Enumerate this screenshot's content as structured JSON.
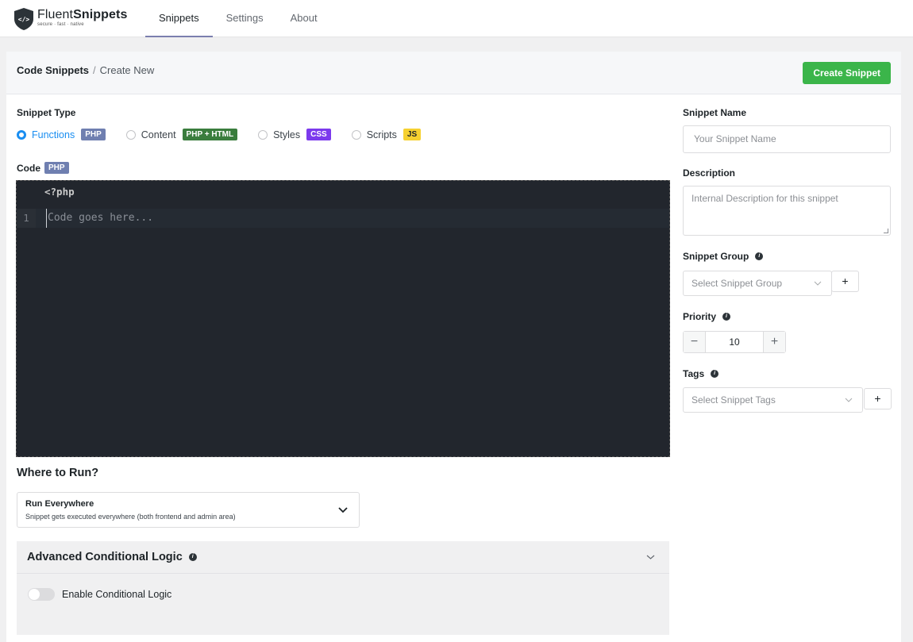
{
  "header": {
    "logo": {
      "name_thin": "Fluent",
      "name_bold": "Snippets",
      "tagline": "secure · fast · native"
    },
    "nav": [
      {
        "label": "Snippets",
        "active": true
      },
      {
        "label": "Settings",
        "active": false
      },
      {
        "label": "About",
        "active": false
      }
    ]
  },
  "breadcrumb": {
    "root": "Code Snippets",
    "separator": "/",
    "current": "Create New"
  },
  "create_button": "Create Snippet",
  "snippet_type": {
    "label": "Snippet Type",
    "options": [
      {
        "name": "Functions",
        "badge": "PHP",
        "selected": true
      },
      {
        "name": "Content",
        "badge": "PHP + HTML",
        "selected": false
      },
      {
        "name": "Styles",
        "badge": "CSS",
        "selected": false
      },
      {
        "name": "Scripts",
        "badge": "JS",
        "selected": false
      }
    ]
  },
  "code": {
    "label": "Code",
    "badge": "PHP",
    "opening_tag": "<?php",
    "line_number": "1",
    "placeholder": "Code goes here..."
  },
  "where_to_run": {
    "label": "Where to Run?",
    "selected_title": "Run Everywhere",
    "selected_desc": "Snippet gets executed everywhere (both frontend and admin area)"
  },
  "advanced": {
    "title": "Advanced Conditional Logic",
    "toggle_label": "Enable Conditional Logic",
    "enabled": false
  },
  "sidebar": {
    "name_label": "Snippet Name",
    "name_placeholder": "Your Snippet Name",
    "description_label": "Description",
    "description_placeholder": "Internal Description for this snippet",
    "group_label": "Snippet Group",
    "group_placeholder": "Select Snippet Group",
    "priority_label": "Priority",
    "priority_value": "10",
    "tags_label": "Tags",
    "tags_placeholder": "Select Snippet Tags",
    "add_symbol": "+",
    "minus_symbol": "−",
    "plus_symbol": "+"
  },
  "colors": {
    "accent_blue": "#1a8ef1",
    "create_green": "#3bb54a",
    "editor_bg": "#22262d"
  }
}
